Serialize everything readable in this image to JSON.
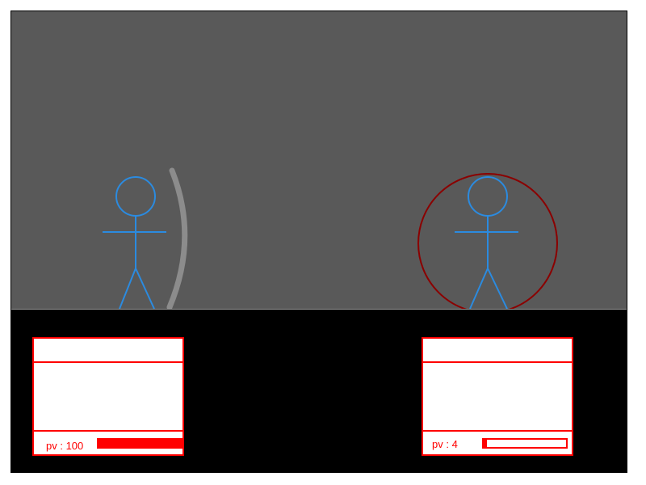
{
  "colors": {
    "arena": "#595959",
    "ground": "#000000",
    "stickman": "#2b8be0",
    "bow": "#8c8c8c",
    "shield": "#8b0000",
    "ui": "#ff0000"
  },
  "player": {
    "pv_label": "pv : 100",
    "hp": 100,
    "hp_max": 100
  },
  "enemy": {
    "pv_label": "pv : 4",
    "hp": 4,
    "hp_max": 100,
    "shielded": true
  }
}
